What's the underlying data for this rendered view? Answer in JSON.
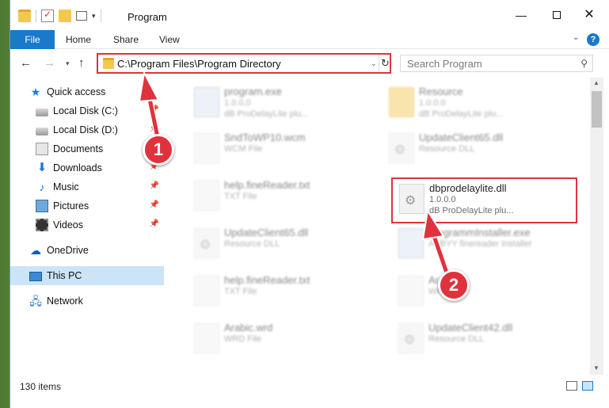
{
  "window": {
    "title": "Program",
    "controls": {
      "minimize": "—",
      "maximize": "",
      "close": "✕"
    }
  },
  "ribbon": {
    "tabs": [
      "File",
      "Home",
      "Share",
      "View"
    ],
    "help": "?"
  },
  "address_bar": {
    "path": "C:\\Program Files\\Program Directory",
    "refresh_icon": "refresh-icon"
  },
  "search": {
    "placeholder": "Search Program"
  },
  "sidebar": {
    "items": [
      {
        "label": "Quick access",
        "icon": "star-icon",
        "pinned": false
      },
      {
        "label": "Local Disk (C:)",
        "icon": "disk-icon",
        "pinned": true
      },
      {
        "label": "Local Disk (D:)",
        "icon": "disk-icon",
        "pinned": true
      },
      {
        "label": "Documents",
        "icon": "documents-icon",
        "pinned": true
      },
      {
        "label": "Downloads",
        "icon": "downloads-icon",
        "pinned": true
      },
      {
        "label": "Music",
        "icon": "music-icon",
        "pinned": true
      },
      {
        "label": "Pictures",
        "icon": "pictures-icon",
        "pinned": true
      },
      {
        "label": "Videos",
        "icon": "videos-icon",
        "pinned": true
      },
      {
        "label": "OneDrive",
        "icon": "onedrive-icon",
        "pinned": false
      },
      {
        "label": "This PC",
        "icon": "this-pc-icon",
        "pinned": false,
        "selected": true
      },
      {
        "label": "Network",
        "icon": "network-icon",
        "pinned": false
      }
    ]
  },
  "files": [
    {
      "name": "program.exe",
      "line2": "1.0.0.0",
      "line3": "dB ProDelayLite plu...",
      "type": "exe"
    },
    {
      "name": "Resource",
      "line2": "1.0.0.0",
      "line3": "dB ProDelayLite plu...",
      "type": "folder"
    },
    {
      "name": "SndToWP10.wcm",
      "line2": "WCM File",
      "line3": "",
      "type": "file"
    },
    {
      "name": "UpdateClient65.dll",
      "line2": "Resource DLL",
      "line3": "",
      "type": "dll"
    },
    {
      "name": "help.fineReader.txt",
      "line2": "TXT File",
      "line3": "",
      "type": "file"
    },
    {
      "name": "dbprodelaylite.dll",
      "line2": "1.0.0.0",
      "line3": "dB ProDelayLite plu...",
      "type": "dll",
      "highlighted": true
    },
    {
      "name": "UpdateClient65.dll",
      "line2": "Resource DLL",
      "line3": "",
      "type": "dll"
    },
    {
      "name": "programmInstaller.exe",
      "line2": "ABBYY finereader Installer",
      "line3": "",
      "type": "exe"
    },
    {
      "name": "help.fineReader.txt",
      "line2": "TXT File",
      "line3": "",
      "type": "file"
    },
    {
      "name": "Arabic",
      "line2": "WRD",
      "line3": "",
      "type": "file"
    },
    {
      "name": "Arabic.wrd",
      "line2": "WRD File",
      "line3": "",
      "type": "file"
    },
    {
      "name": "UpdateClient42.dll",
      "line2": "Resource DLL",
      "line3": "",
      "type": "dll"
    }
  ],
  "status": {
    "items_count": "130 items"
  },
  "annotations": {
    "step1": "1",
    "step2": "2",
    "color": "#e0323c"
  }
}
